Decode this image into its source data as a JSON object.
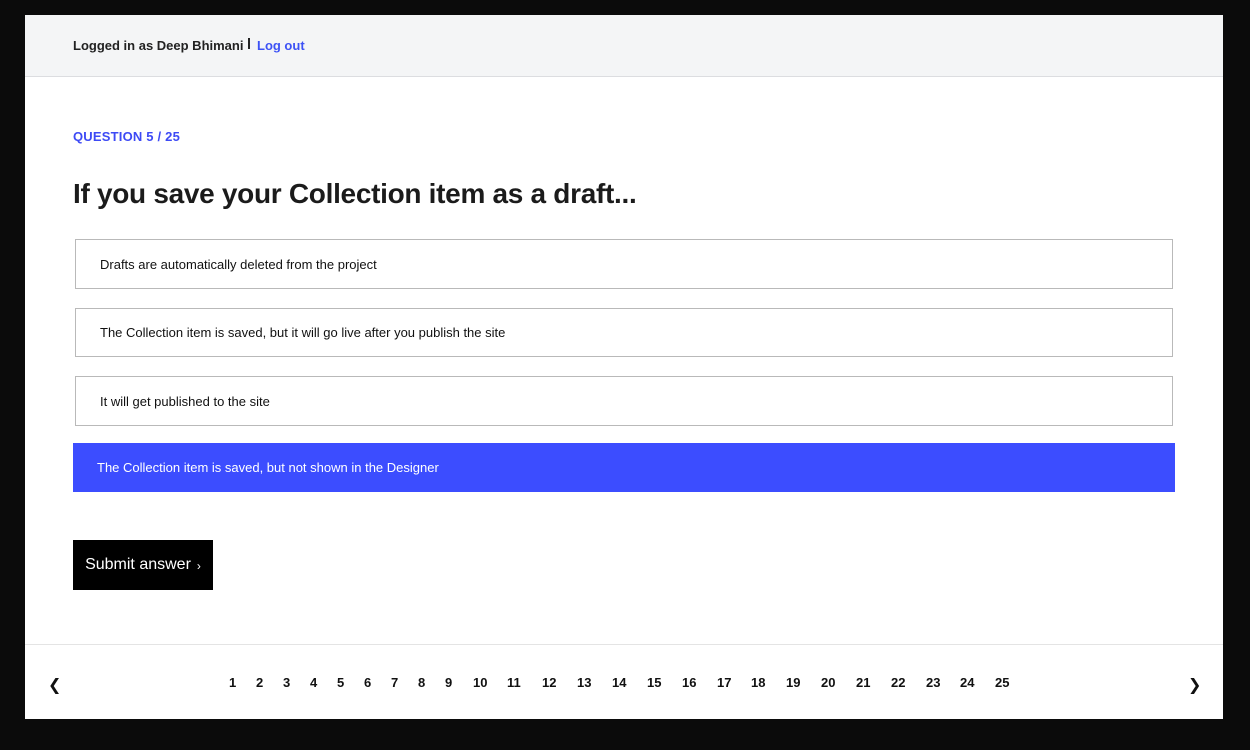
{
  "header": {
    "logged_in_text": "Logged in as Deep Bhimani",
    "logout_label": "Log out"
  },
  "question": {
    "counter": "QUESTION 5 / 25",
    "title": "If you save your Collection item as a draft...",
    "options": [
      {
        "label": "Drafts are automatically deleted from the project",
        "selected": false
      },
      {
        "label": "The Collection item is saved, but it will go live after you publish the site",
        "selected": false
      },
      {
        "label": "It will get published to the site",
        "selected": false
      },
      {
        "label": "The Collection item is saved, but not shown in the Designer",
        "selected": true
      }
    ]
  },
  "submit": {
    "label": "Submit answer",
    "chevron": "›"
  },
  "pagination": {
    "prev": "❮",
    "next": "❯",
    "pages": [
      "1",
      "2",
      "3",
      "4",
      "5",
      "6",
      "7",
      "8",
      "9",
      "10",
      "11",
      "12",
      "13",
      "14",
      "15",
      "16",
      "17",
      "18",
      "19",
      "20",
      "21",
      "22",
      "23",
      "24",
      "25"
    ]
  },
  "colors": {
    "accent": "#3c4dff",
    "link": "#3d52f5"
  }
}
